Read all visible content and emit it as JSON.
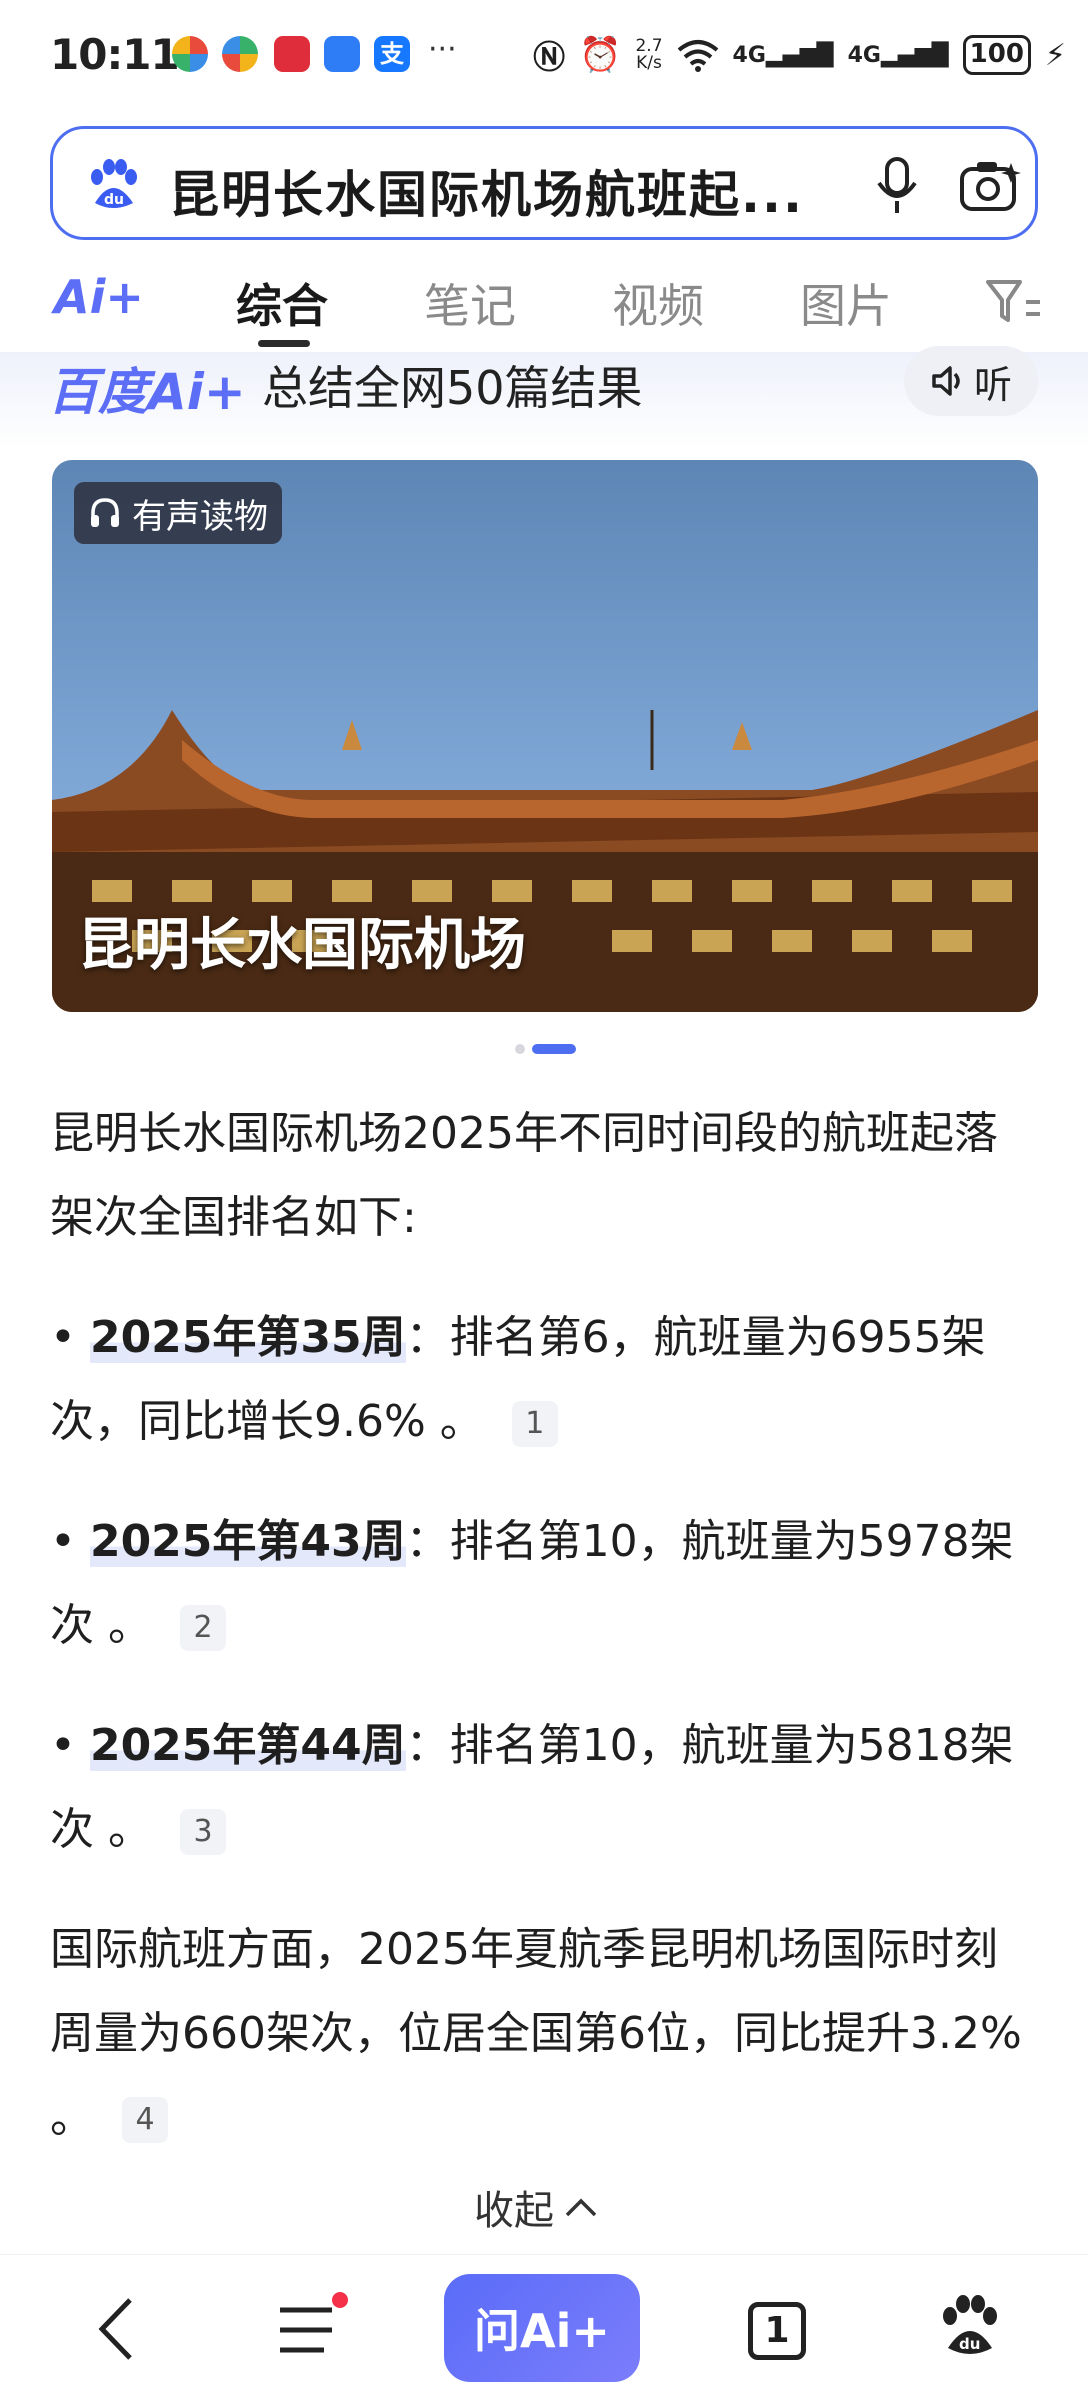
{
  "status_bar": {
    "time": "10:11",
    "net_speed_value": "2.7",
    "net_speed_unit": "K/s",
    "sim1": "4G",
    "sim2": "4G",
    "battery": "100",
    "more": "···"
  },
  "search": {
    "query": "昆明长水国际机场航班起..."
  },
  "tabs": {
    "ai": "Ai+",
    "items": [
      "综合",
      "笔记",
      "视频",
      "图片"
    ]
  },
  "ai_summary": {
    "logo": "百度Ai+",
    "text": "总结全网50篇结果",
    "listen": "听"
  },
  "hero": {
    "badge": "有声读物",
    "title": "昆明长水国际机场"
  },
  "content": {
    "intro": "昆明长水国际机场2025年不同时间段的航班起落架次全国排名如下:",
    "bullets": [
      {
        "label": "2025年第35周",
        "text": "：排名第6，航班量为6955架次，同比增长9.6% 。",
        "cite": "1"
      },
      {
        "label": "2025年第43周",
        "text": "：排名第10，航班量为5978架次 。",
        "cite": "2"
      },
      {
        "label": "2025年第44周",
        "text": "：排名第10，航班量为5818架次 。",
        "cite": "3"
      }
    ],
    "intl": "国际航班方面，2025年夏航季昆明机场国际时刻周量为660架次，位居全国第6位，同比提升3.2% 。",
    "intl_cite": "4",
    "collapse": "收起"
  },
  "bottom_nav": {
    "ask_ai": "问Ai+",
    "tab_count": "1"
  },
  "colors": {
    "accent": "#4e6ef2",
    "highlight": "#e3e8fb",
    "notification_dot": "#f5314a"
  }
}
